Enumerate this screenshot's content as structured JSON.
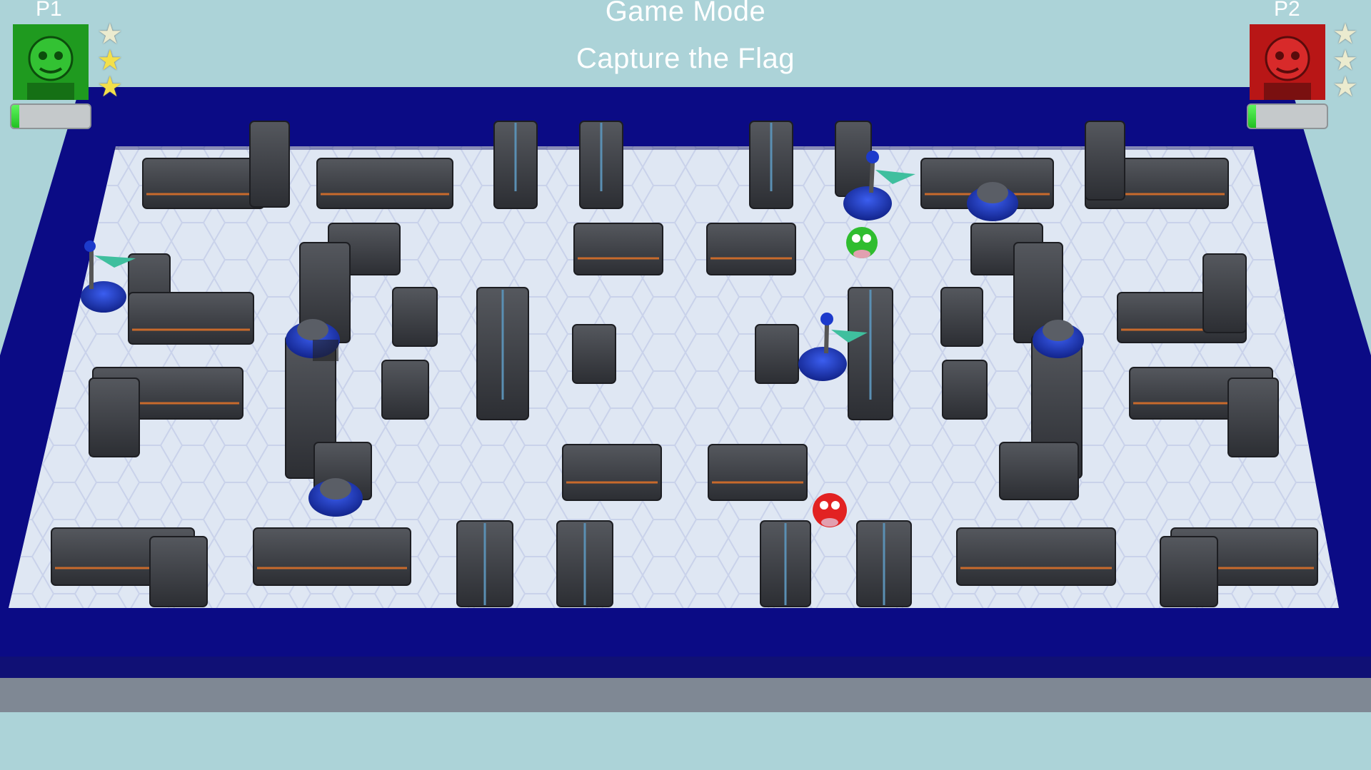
{
  "header": {
    "mode_label": "Game Mode",
    "mode_name": "Capture the Flag"
  },
  "players": [
    {
      "label": "P1",
      "portrait_icon": "green-monkey-avatar-icon",
      "color": "#1f9a1f",
      "stars_filled": 2,
      "stars_total": 3,
      "health": 0.1
    },
    {
      "label": "P2",
      "portrait_icon": "red-monkey-avatar-icon",
      "color": "#b81616",
      "stars_filled": 0,
      "stars_total": 3,
      "health": 0.1
    }
  ],
  "colors": {
    "arena_border": "#0b0b85",
    "floor": "#dfe7f3",
    "wall": "#3b3d42",
    "wall_stripe": "#c86a2c",
    "turret": "#1c3acb",
    "flag": "#3fbf9e"
  }
}
